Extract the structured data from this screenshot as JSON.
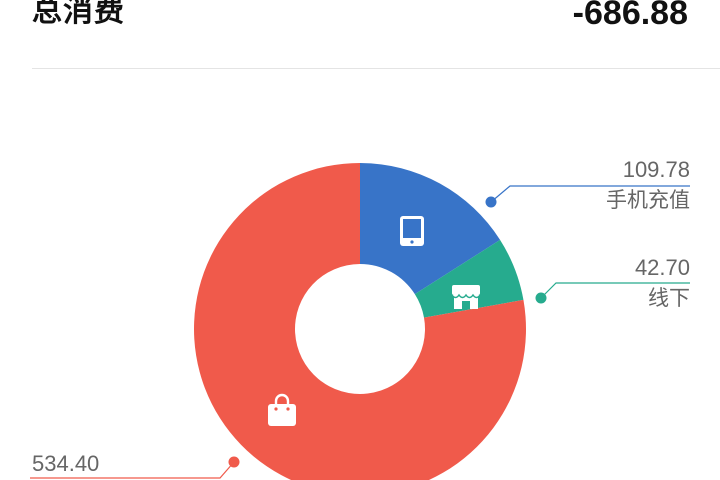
{
  "header": {
    "title": "总消费",
    "total": "-686.88"
  },
  "colors": {
    "phone": "#3874c8",
    "offline": "#26ab8e",
    "shopping": "#f05a4b"
  },
  "chart_data": {
    "type": "pie",
    "donut": true,
    "slices": [
      {
        "label": "手机充值",
        "value": 109.78,
        "color": "#3874c8",
        "icon": "tablet-icon"
      },
      {
        "label": "线下",
        "value": 42.7,
        "color": "#26ab8e",
        "icon": "store-icon"
      },
      {
        "label": "",
        "value": 534.4,
        "color": "#f05a4b",
        "icon": "shopping-bag-icon"
      }
    ]
  },
  "callouts": {
    "phone": {
      "value": "109.78",
      "label": "手机充值"
    },
    "offline": {
      "value": "42.70",
      "label": "线下"
    },
    "shopping": {
      "value": "534.40"
    }
  }
}
